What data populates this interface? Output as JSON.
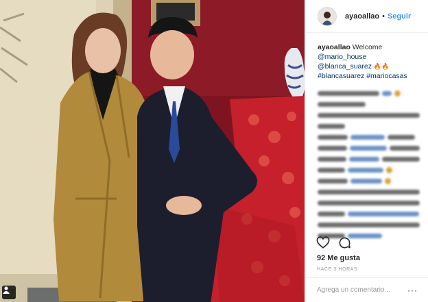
{
  "header": {
    "username": "ayaoallao",
    "separator": "•",
    "follow_label": "Seguir",
    "avatar_icon": "profile-avatar"
  },
  "caption": {
    "username": "ayaoallao",
    "text": "Welcome",
    "mentions": [
      "@mario_house",
      "@blanca_suarez"
    ],
    "emojis": "🔥🔥",
    "hashtags": [
      "#blancasuarez",
      "#mariocasas"
    ]
  },
  "actions": {
    "like_icon": "heart-icon",
    "comment_icon": "comment-icon"
  },
  "likes_label": "92 Me gusta",
  "time_label": "HACE 3 HORAS",
  "add_comment": {
    "placeholder": "Agrega un comentario...",
    "more_label": "···"
  },
  "photo": {
    "user_tag_icon": "user-tag-icon"
  },
  "colors": {
    "follow_blue": "#3897f0",
    "link": "#003569",
    "muted": "#999999"
  }
}
